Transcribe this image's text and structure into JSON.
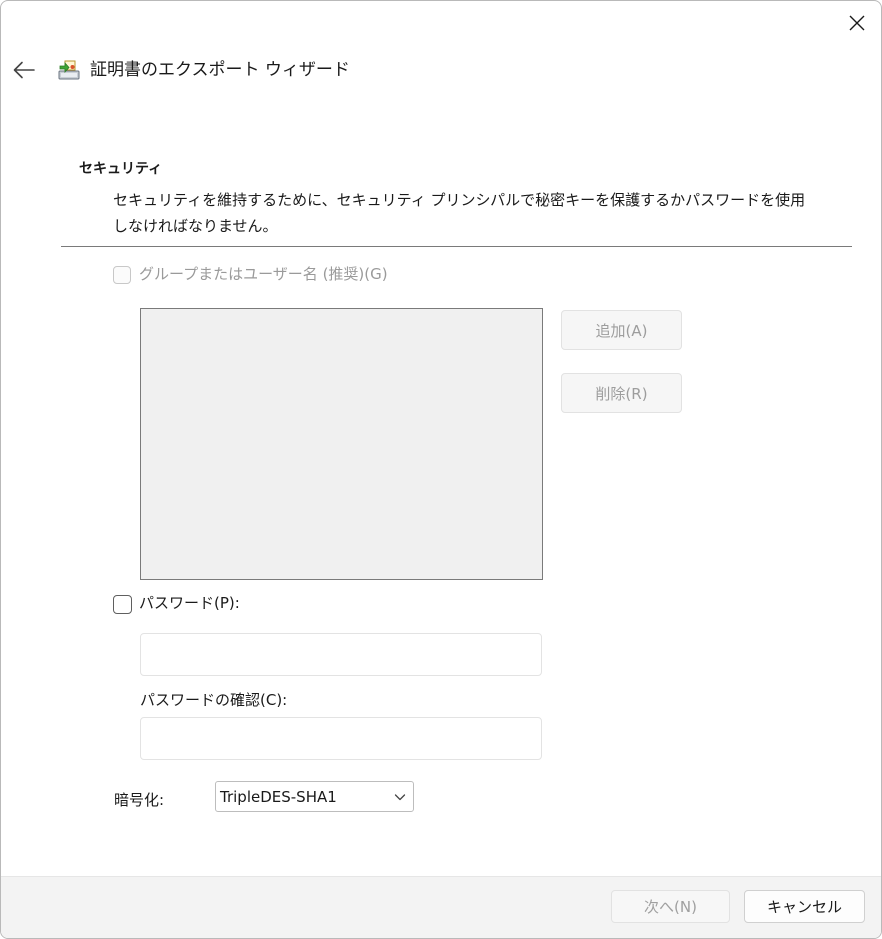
{
  "window": {
    "title": "証明書のエクスポート ウィザード",
    "icons": {
      "back": "back-arrow-icon",
      "close": "close-icon",
      "wizard": "certificate-export-icon"
    }
  },
  "security": {
    "heading": "セキュリティ",
    "description": "セキュリティを維持するために、セキュリティ プリンシパルで秘密キーを保護するかパスワードを使用しなければなりません。"
  },
  "group_option": {
    "label": "グループまたはユーザー名 (推奨)(G)",
    "checked": false,
    "enabled": false,
    "list_items": []
  },
  "buttons": {
    "add": "追加(A)",
    "remove": "削除(R)",
    "next": "次へ(N)",
    "cancel": "キャンセル"
  },
  "password_option": {
    "label": "パスワード(P):",
    "checked": false,
    "password_value": "",
    "confirm_label": "パスワードの確認(C):",
    "confirm_value": ""
  },
  "encryption": {
    "label": "暗号化:",
    "selected": "TripleDES-SHA1",
    "chevron_icon": "chevron-down-icon"
  }
}
